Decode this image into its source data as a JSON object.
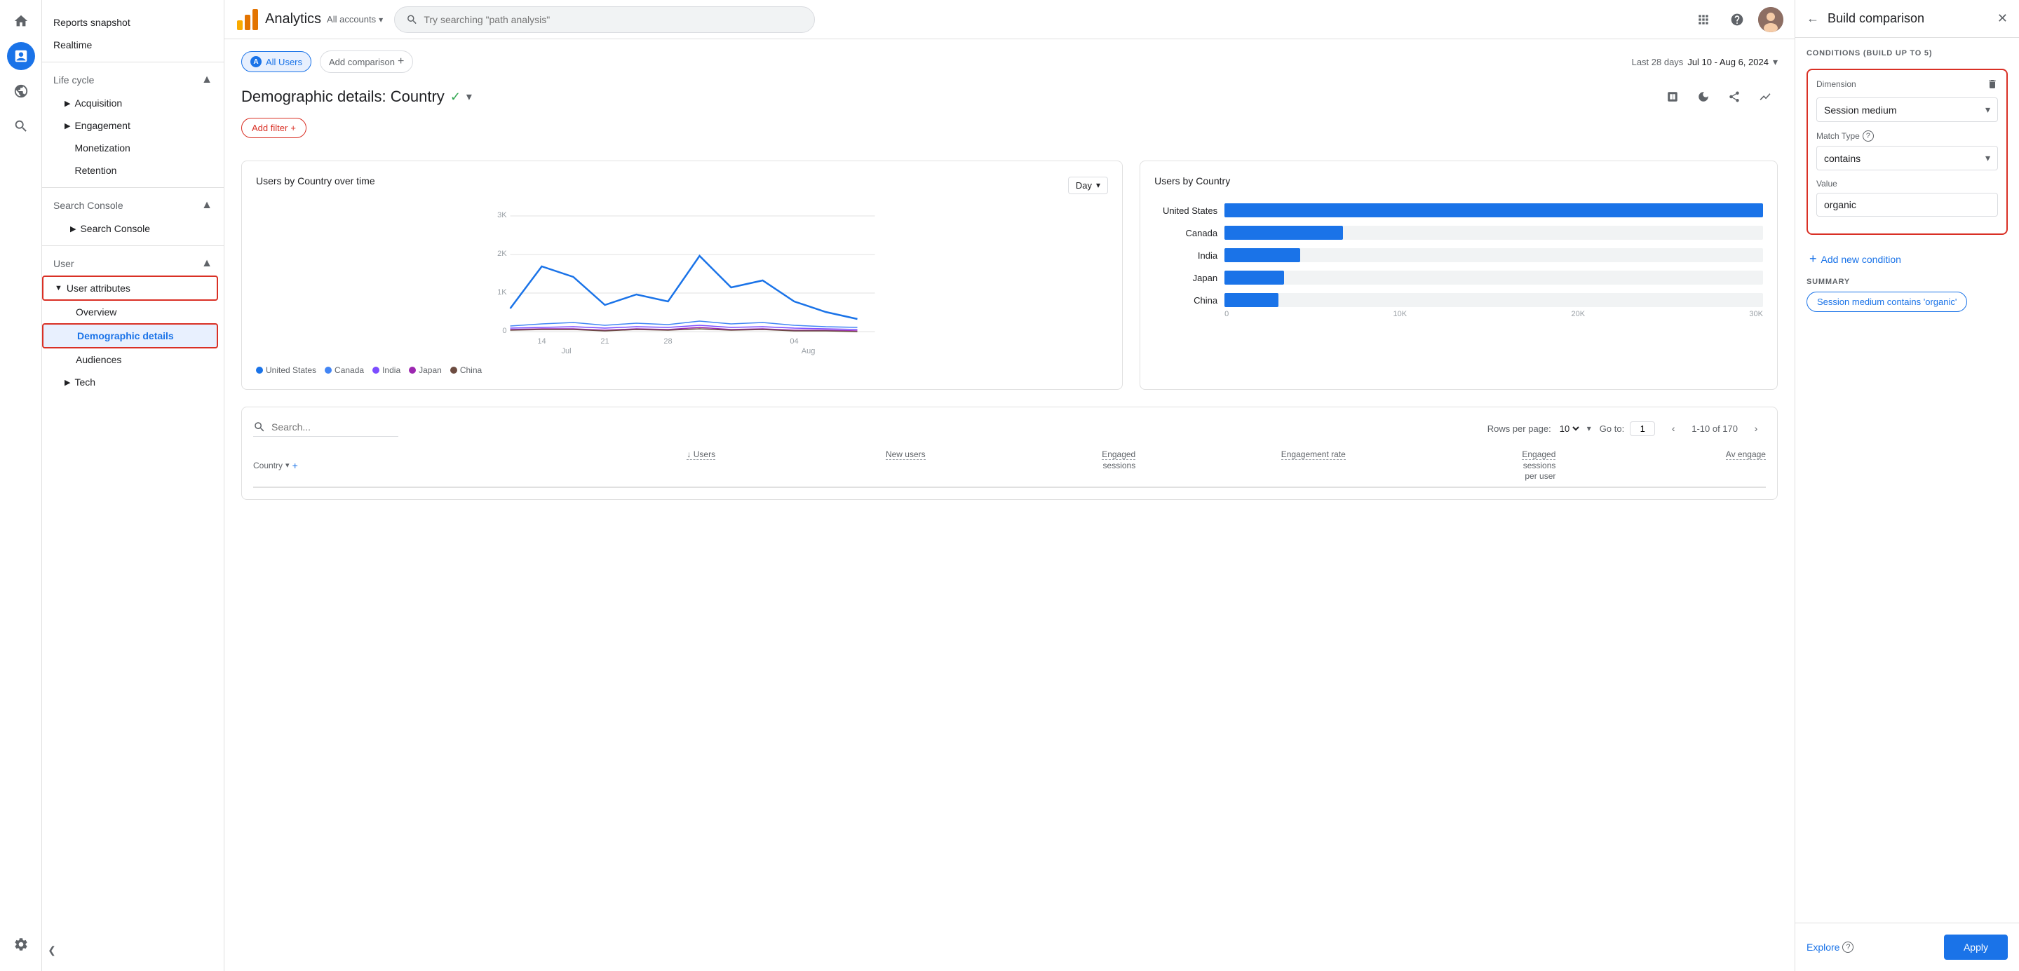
{
  "app": {
    "title": "Analytics",
    "account": "All accounts",
    "search_placeholder": "Try searching \"path analysis\""
  },
  "left_nav": {
    "icons": [
      "home",
      "bar-chart",
      "people",
      "search"
    ]
  },
  "sidebar": {
    "top_items": [
      {
        "label": "Reports snapshot",
        "id": "reports-snapshot"
      },
      {
        "label": "Realtime",
        "id": "realtime"
      }
    ],
    "lifecycle_label": "Life cycle",
    "lifecycle_items": [
      {
        "label": "Acquisition",
        "id": "acquisition"
      },
      {
        "label": "Engagement",
        "id": "engagement"
      },
      {
        "label": "Monetization",
        "id": "monetization"
      },
      {
        "label": "Retention",
        "id": "retention"
      }
    ],
    "search_console_label": "Search Console",
    "search_console_items": [
      {
        "label": "Search Console",
        "id": "search-console"
      }
    ],
    "user_label": "User",
    "user_items": [
      {
        "label": "User attributes",
        "id": "user-attributes",
        "highlighted": true
      },
      {
        "label": "Overview",
        "id": "overview"
      },
      {
        "label": "Demographic details",
        "id": "demographic-details",
        "active": true
      },
      {
        "label": "Audiences",
        "id": "audiences"
      }
    ],
    "tech_label": "Tech",
    "settings_label": "Settings",
    "collapse_label": "Collapse"
  },
  "filter_bar": {
    "segment_label": "A",
    "segment_text": "All Users",
    "add_comparison": "Add comparison",
    "last_days": "Last 28 days",
    "date_range": "Jul 10 - Aug 6, 2024"
  },
  "page": {
    "title": "Demographic details: Country",
    "add_filter": "Add filter"
  },
  "line_chart": {
    "title": "Users by Country over time",
    "day_option": "Day",
    "y_max": "3K",
    "y_mid1": "2K",
    "y_mid2": "1K",
    "y_min": "0",
    "x_labels": [
      "14",
      "21",
      "28",
      "04"
    ],
    "x_months": [
      "Jul",
      "Aug"
    ],
    "legend": [
      {
        "label": "United States",
        "color": "#1a73e8"
      },
      {
        "label": "Canada",
        "color": "#4285f4"
      },
      {
        "label": "India",
        "color": "#7c4dff"
      },
      {
        "label": "Japan",
        "color": "#9c27b0"
      },
      {
        "label": "China",
        "color": "#6d4c41"
      }
    ]
  },
  "bar_chart": {
    "title": "Users by Country",
    "countries": [
      {
        "label": "United States",
        "value": 32000,
        "pct": 100
      },
      {
        "label": "Canada",
        "value": 8000,
        "pct": 22
      },
      {
        "label": "India",
        "value": 5000,
        "pct": 14
      },
      {
        "label": "Japan",
        "value": 4000,
        "pct": 11
      },
      {
        "label": "China",
        "value": 3500,
        "pct": 10
      }
    ],
    "axis_labels": [
      "0",
      "10K",
      "20K",
      "30K"
    ]
  },
  "table": {
    "search_placeholder": "Search...",
    "rows_per_page_label": "Rows per page:",
    "rows_per_page": "10",
    "goto_label": "Go to:",
    "goto_value": "1",
    "pagination": "1-10 of 170",
    "columns": [
      {
        "label": "Country",
        "id": "country"
      },
      {
        "label": "↓ Users",
        "id": "users"
      },
      {
        "label": "New users",
        "id": "new-users"
      },
      {
        "label": "Engaged sessions",
        "id": "engaged-sessions"
      },
      {
        "label": "Engagement rate",
        "id": "engagement-rate"
      },
      {
        "label": "Engaged sessions per user",
        "id": "engaged-sessions-per-user"
      },
      {
        "label": "Av engage",
        "id": "avg-engagement"
      }
    ]
  },
  "right_panel": {
    "title": "Build comparison",
    "conditions_label": "CONDITIONS (BUILD UP TO 5)",
    "dimension_label": "Dimension",
    "dimension_value": "Session medium",
    "dimension_delete": "delete",
    "match_type_label": "Match Type",
    "match_type_value": "contains",
    "value_label": "Value",
    "value_text": "organic",
    "add_condition": "Add new condition",
    "summary_label": "SUMMARY",
    "summary_text": "Session medium contains 'organic'",
    "explore_label": "Explore",
    "apply_label": "Apply"
  }
}
